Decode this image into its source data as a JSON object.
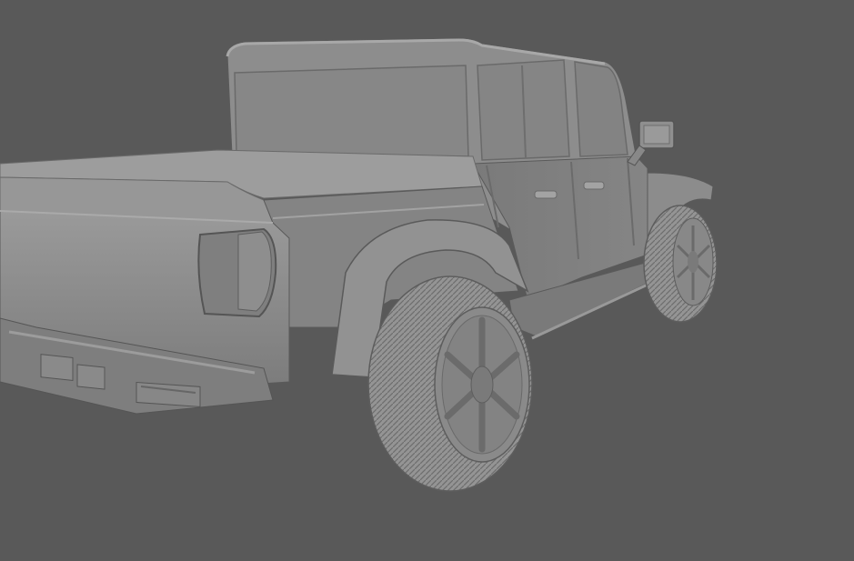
{
  "scene": {
    "background_color": "#595959",
    "model_fill": "#8a8a8a",
    "model_light": "#9e9e9e",
    "model_dark": "#6f6f6f",
    "edge_color": "#4a4a4a"
  }
}
